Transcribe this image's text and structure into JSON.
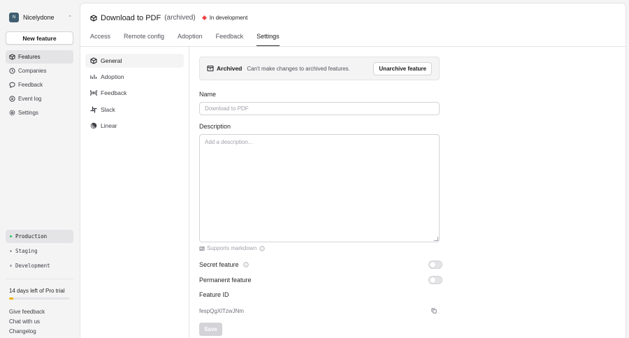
{
  "workspace": {
    "initial": "N",
    "name": "Nicelydone"
  },
  "sidebar": {
    "new_feature_label": "New feature",
    "items": [
      {
        "label": "Features",
        "icon": "box-icon",
        "active": true
      },
      {
        "label": "Companies",
        "icon": "clock-icon",
        "active": false
      },
      {
        "label": "Feedback",
        "icon": "chat-icon",
        "active": false
      },
      {
        "label": "Event log",
        "icon": "list-icon",
        "active": false
      },
      {
        "label": "Settings",
        "icon": "gear-icon",
        "active": false
      }
    ],
    "environments": [
      {
        "label": "Production",
        "color": "#22c55e",
        "active": true
      },
      {
        "label": "Staging",
        "color": "#a1a1aa",
        "active": false
      },
      {
        "label": "Development",
        "color": "#a1a1aa",
        "active": false
      }
    ],
    "trial_text": "14 days left of Pro trial",
    "trial_progress": 0.07,
    "footer_links": [
      "Give feedback",
      "Chat with us",
      "Changelog"
    ]
  },
  "header": {
    "title": "Download to PDF",
    "archived_tag": "(archived)",
    "status": "In development",
    "status_color": "#ef4444"
  },
  "tabs": [
    "Access",
    "Remote config",
    "Adoption",
    "Feedback",
    "Settings"
  ],
  "active_tab": "Settings",
  "subnav": [
    {
      "label": "General",
      "icon": "box-icon",
      "active": true
    },
    {
      "label": "Adoption",
      "icon": "bar-chart-icon",
      "active": false
    },
    {
      "label": "Feedback",
      "icon": "broadcast-icon",
      "active": false
    },
    {
      "label": "Slack",
      "icon": "slack-icon",
      "active": false
    },
    {
      "label": "Linear",
      "icon": "linear-icon",
      "active": false
    }
  ],
  "settings": {
    "banner_title": "Archived",
    "banner_text": "Can't make changes to archived features.",
    "unarchive_label": "Unarchive feature",
    "name_label": "Name",
    "name_placeholder": "Download to PDF",
    "description_label": "Description",
    "description_placeholder": "Add a description...",
    "markdown_hint": "Supports markdown",
    "secret_label": "Secret feature",
    "secret_on": false,
    "permanent_label": "Permanent feature",
    "permanent_on": false,
    "feature_id_label": "Feature ID",
    "feature_id_value": "fespQgXlTzwJNm",
    "save_label": "Save"
  }
}
